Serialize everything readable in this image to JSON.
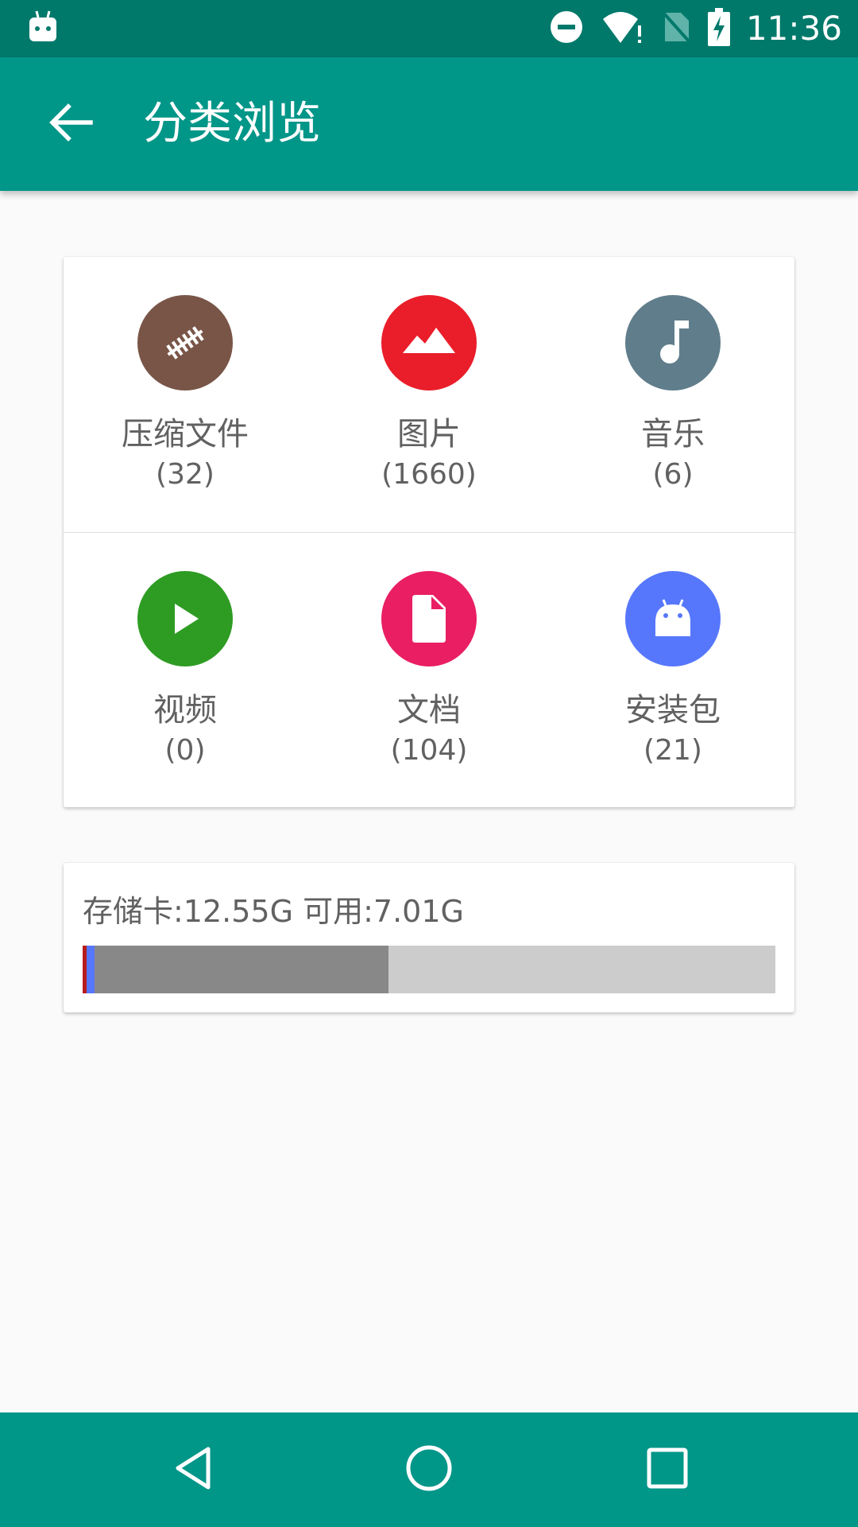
{
  "status_bar": {
    "time": "11:36",
    "icons": [
      "android-debug-icon",
      "do-not-disturb-icon",
      "wifi-icon",
      "no-sim-icon",
      "battery-charging-icon"
    ]
  },
  "app_bar": {
    "title": "分类浏览",
    "back_icon": "arrow-back-icon"
  },
  "categories": [
    {
      "label": "压缩文件",
      "count": "(32)",
      "color": "#795548",
      "icon": "zip-icon"
    },
    {
      "label": "图片",
      "count": "(1660)",
      "color": "#e91e2a",
      "icon": "image-icon"
    },
    {
      "label": "音乐",
      "count": "(6)",
      "color": "#607d8b",
      "icon": "music-note-icon"
    },
    {
      "label": "视频",
      "count": "(0)",
      "color": "#2e9c23",
      "icon": "play-icon"
    },
    {
      "label": "文档",
      "count": "(104)",
      "color": "#e91e63",
      "icon": "document-icon"
    },
    {
      "label": "安装包",
      "count": "(21)",
      "color": "#5677fc",
      "icon": "android-icon"
    }
  ],
  "storage": {
    "text": "存储卡:12.55G 可用:7.01G",
    "usage_segments": [
      {
        "color": "#b71c1c",
        "fraction": 0.006
      },
      {
        "color": "#5677fc",
        "fraction": 0.011
      },
      {
        "color": "#888888",
        "fraction": 0.424
      }
    ],
    "free_color": "#cccccc"
  },
  "colors": {
    "primary": "#009688",
    "primary_dark": "#00796b"
  },
  "nav_bar": {
    "buttons": [
      "back-nav-icon",
      "home-nav-icon",
      "recents-nav-icon"
    ]
  }
}
